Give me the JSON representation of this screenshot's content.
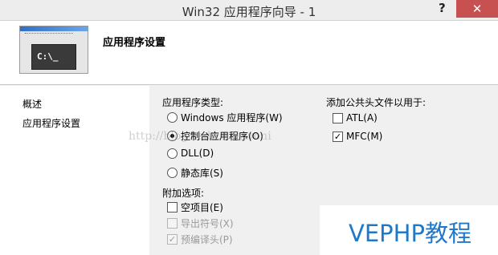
{
  "window": {
    "title": "Win32 应用程序向导 - 1",
    "help": "?",
    "close": "✕"
  },
  "header": {
    "title": "应用程序设置",
    "icon_prompt": "C:\\_"
  },
  "nav": {
    "items": [
      {
        "label": "概述"
      },
      {
        "label": "应用程序设置"
      }
    ]
  },
  "app_type": {
    "label": "应用程序类型:",
    "options": [
      {
        "label": "Windows 应用程序(W)",
        "selected": false
      },
      {
        "label": "控制台应用程序(O)",
        "selected": true
      },
      {
        "label": "DLL(D)",
        "selected": false
      },
      {
        "label": "静态库(S)",
        "selected": false
      }
    ]
  },
  "additional": {
    "label": "附加选项:",
    "options": [
      {
        "label": "空项目(E)",
        "checked": false,
        "enabled": true
      },
      {
        "label": "导出符号(X)",
        "checked": false,
        "enabled": false
      },
      {
        "label": "预编译头(P)",
        "checked": true,
        "enabled": false
      }
    ]
  },
  "common_headers": {
    "label": "添加公共头文件以用于:",
    "options": [
      {
        "label": "ATL(A)",
        "checked": false
      },
      {
        "label": "MFC(M)",
        "checked": true
      }
    ]
  },
  "watermark": "http://blog.csdn.net/woni",
  "logo": "VEPHP教程",
  "colors": {
    "close_button": "#c75050",
    "logo": "#1f78c8"
  }
}
